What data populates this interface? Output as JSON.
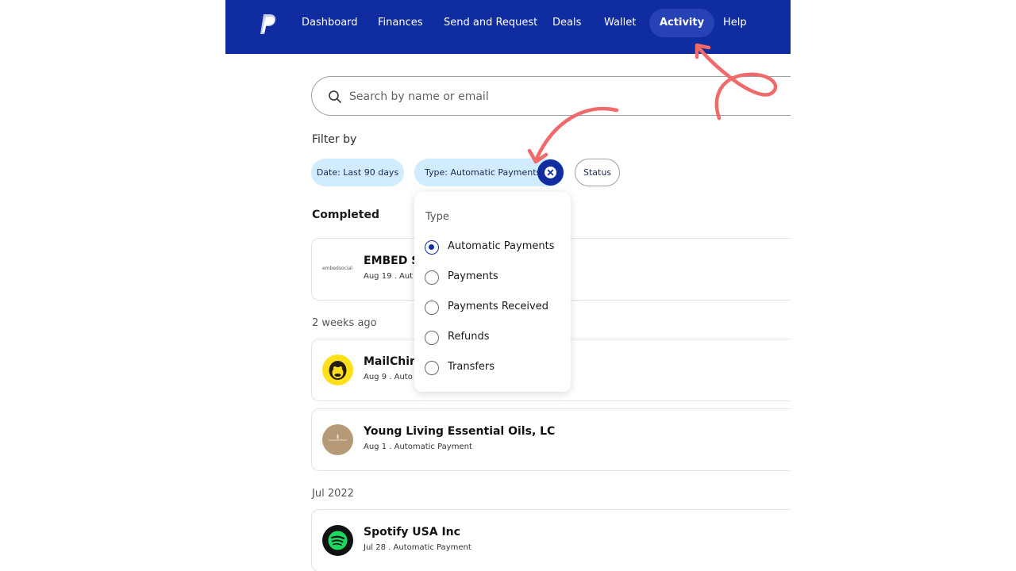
{
  "nav": {
    "items": [
      {
        "label": "Dashboard"
      },
      {
        "label": "Finances"
      },
      {
        "label": "Send and Request"
      },
      {
        "label": "Deals"
      },
      {
        "label": "Wallet"
      },
      {
        "label": "Activity",
        "active": true
      },
      {
        "label": "Help"
      }
    ]
  },
  "search": {
    "placeholder": "Search by name or email"
  },
  "filters": {
    "label": "Filter by",
    "chips": [
      "Date: Last 90 days",
      "Type: Automatic Payments",
      "Status"
    ]
  },
  "type_dropdown": {
    "title": "Type",
    "options": [
      "Automatic Payments",
      "Payments",
      "Payments Received",
      "Refunds",
      "Transfers"
    ],
    "selected": "Automatic Payments"
  },
  "activity": {
    "section_title": "Completed",
    "groups": [
      {
        "label": "2 weeks ago"
      },
      {
        "label": "Jul 2022"
      }
    ],
    "transactions": [
      {
        "name": "EMBED SC",
        "date": "Aug 19",
        "type": "Aut",
        "logo_text": "embedsocial"
      },
      {
        "name": "MailChimp",
        "date": "Aug 9",
        "type": "Auto"
      },
      {
        "name": "Young Living Essential Oils, LC",
        "date": "Aug 1",
        "type": "Automatic Payment"
      },
      {
        "name": "Spotify USA Inc",
        "date": "Jul 28",
        "type": "Automatic Payment"
      }
    ]
  },
  "colors": {
    "nav_bg": "#0f2da0",
    "chip_bg": "#d1ebff",
    "annotation_arrow": "#f06a6a"
  }
}
